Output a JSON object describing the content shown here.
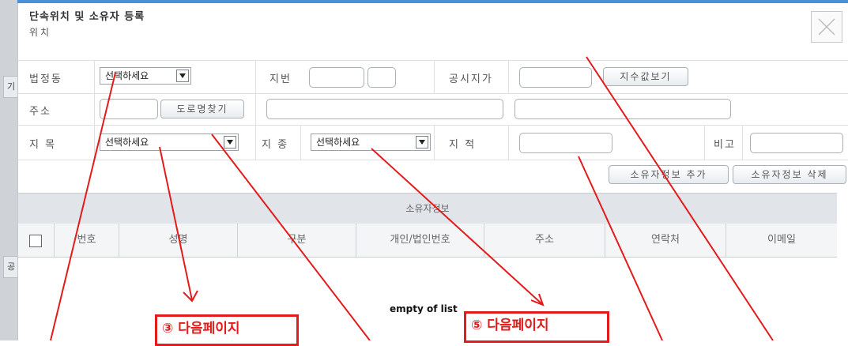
{
  "dialog": {
    "title": "단속위치 및 소유자 등록",
    "subtitle": "위치",
    "close_icon": "close-icon"
  },
  "bg": {
    "tab1": "기",
    "tab2": "공"
  },
  "fields": {
    "beopjeongdong_label": "법정동",
    "beopjeongdong_select": "선택하세요",
    "jibeon_label": "지번",
    "gongsi_label": "공시지가",
    "jisu_button": "지수값보기",
    "juso_label": "주소",
    "road_button": "도로명찾기",
    "jimok_label": "지 목",
    "jimok_select": "선택하세요",
    "jijong_label": "지 종",
    "jijong_select": "선택하세요",
    "jijeok_label": "지 적",
    "bigo_label": "비고",
    "add_owner": "소유자정보 추가",
    "del_owner": "소유자정보 삭제"
  },
  "grid": {
    "title": "소유자정보",
    "columns": [
      "번호",
      "성명",
      "구분",
      "개인/법인번호",
      "주소",
      "연락처",
      "이메일"
    ],
    "empty": "empty of list"
  },
  "annotations": {
    "callout1": "③ 다음페이지",
    "callout2": "⑤ 다음페이지",
    "color": "#e31b1b"
  }
}
